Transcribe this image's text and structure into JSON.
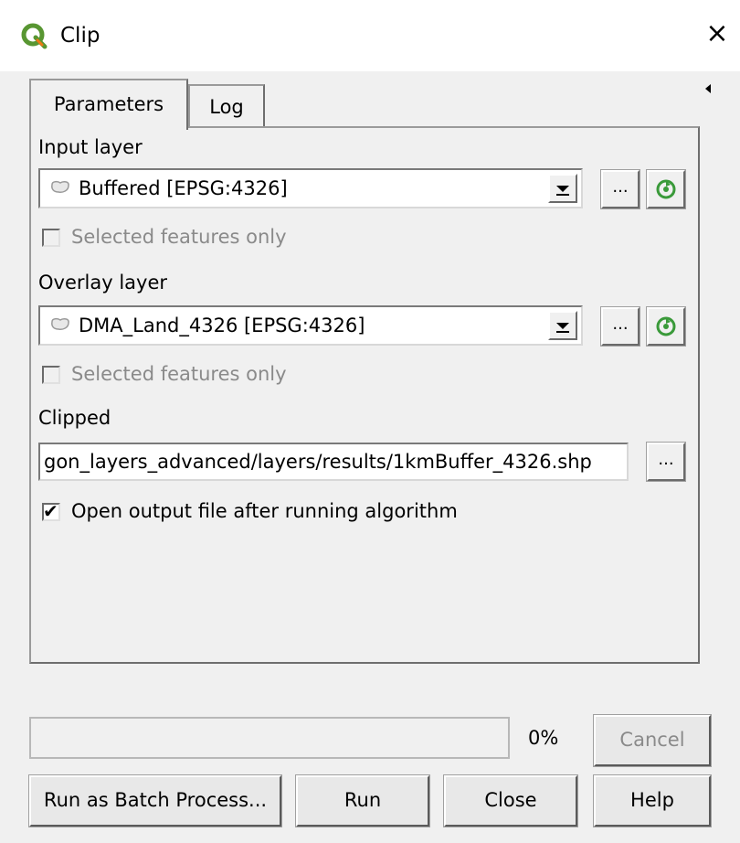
{
  "window": {
    "title": "Clip",
    "close_glyph": "×"
  },
  "tabs": [
    {
      "label": "Parameters",
      "active": true
    },
    {
      "label": "Log",
      "active": false
    }
  ],
  "params": {
    "input_layer": {
      "label": "Input layer",
      "value": "Buffered [EPSG:4326]",
      "browse_label": "...",
      "selected_only_label": "Selected features only",
      "selected_only_checked": false
    },
    "overlay_layer": {
      "label": "Overlay layer",
      "value": "DMA_Land_4326 [EPSG:4326]",
      "browse_label": "...",
      "selected_only_label": "Selected features only",
      "selected_only_checked": false
    },
    "clipped": {
      "label": "Clipped",
      "value": "gon_layers_advanced/layers/results/1kmBuffer_4326.shp",
      "browse_label": "..."
    },
    "open_output": {
      "label": "Open output file after running algorithm",
      "checked": true,
      "check_glyph": "✔"
    }
  },
  "progress": {
    "value": 0,
    "text": "0%"
  },
  "buttons": {
    "cancel": "Cancel",
    "batch": "Run as Batch Process...",
    "run": "Run",
    "close": "Close",
    "help": "Help"
  },
  "colors": {
    "qgis_green": "#589632",
    "qgis_yellow": "#ee7913",
    "iterate_green": "#3a9a3a"
  },
  "icons": {
    "app": "qgis-logo-icon",
    "layer": "polygon-layer-icon",
    "iterate": "iterate-over-features-icon"
  }
}
